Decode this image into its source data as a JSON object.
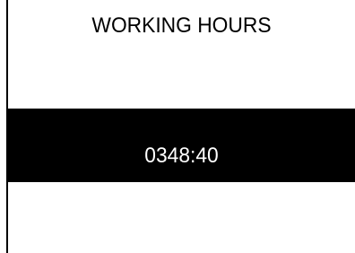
{
  "screen": {
    "title": "WORKING HOURS",
    "working_hours_value": "0348:40"
  }
}
